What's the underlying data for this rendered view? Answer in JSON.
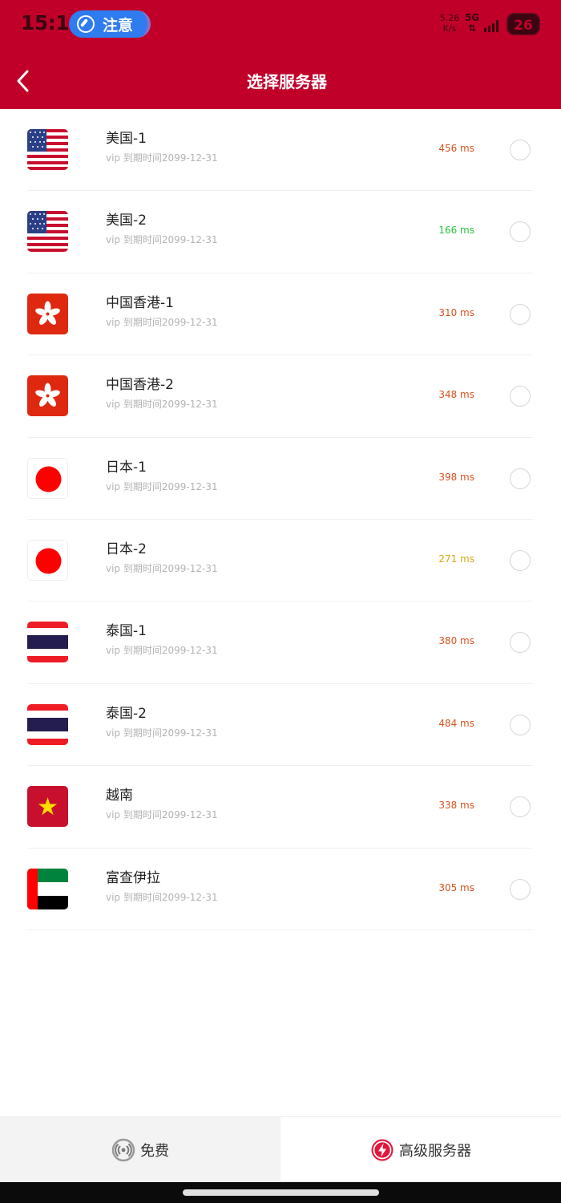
{
  "status_bar": {
    "time": "15:16",
    "notice_label": "注意",
    "net_speed_value": "5.26",
    "net_speed_unit": "K/s",
    "network": "5G",
    "battery": "26"
  },
  "header": {
    "title": "选择服务器"
  },
  "servers": [
    {
      "name": "美国-1",
      "subtitle": "vip  到期时间2099-12-31",
      "latency": "456  ms",
      "latency_color": "#d9521f",
      "flag": "us-flag-icon"
    },
    {
      "name": "美国-2",
      "subtitle": "vip  到期时间2099-12-31",
      "latency": "166  ms",
      "latency_color": "#27c23a",
      "flag": "us-flag-icon"
    },
    {
      "name": "中国香港-1",
      "subtitle": "vip  到期时间2099-12-31",
      "latency": "310  ms",
      "latency_color": "#d9521f",
      "flag": "hk-flag-icon"
    },
    {
      "name": "中国香港-2",
      "subtitle": "vip  到期时间2099-12-31",
      "latency": "348  ms",
      "latency_color": "#d9521f",
      "flag": "hk-flag-icon"
    },
    {
      "name": "日本-1",
      "subtitle": "vip  到期时间2099-12-31",
      "latency": "398  ms",
      "latency_color": "#d9521f",
      "flag": "jp-flag-icon"
    },
    {
      "name": "日本-2",
      "subtitle": "vip  到期时间2099-12-31",
      "latency": "271  ms",
      "latency_color": "#d4a80f",
      "flag": "jp-flag-icon"
    },
    {
      "name": "泰国-1",
      "subtitle": "vip  到期时间2099-12-31",
      "latency": "380  ms",
      "latency_color": "#d9521f",
      "flag": "th-flag-icon"
    },
    {
      "name": "泰国-2",
      "subtitle": "vip  到期时间2099-12-31",
      "latency": "484  ms",
      "latency_color": "#d9521f",
      "flag": "th-flag-icon"
    },
    {
      "name": "越南",
      "subtitle": "vip  到期时间2099-12-31",
      "latency": "338  ms",
      "latency_color": "#d9521f",
      "flag": "vn-flag-icon"
    },
    {
      "name": "富查伊拉",
      "subtitle": "vip  到期时间2099-12-31",
      "latency": "305  ms",
      "latency_color": "#d9521f",
      "flag": "ae-flag-icon"
    }
  ],
  "tabs": {
    "free_label": "免费",
    "premium_label": "高级服务器"
  },
  "colors": {
    "brand": "#c1002a",
    "accent_blue": "#2f7bf0"
  }
}
